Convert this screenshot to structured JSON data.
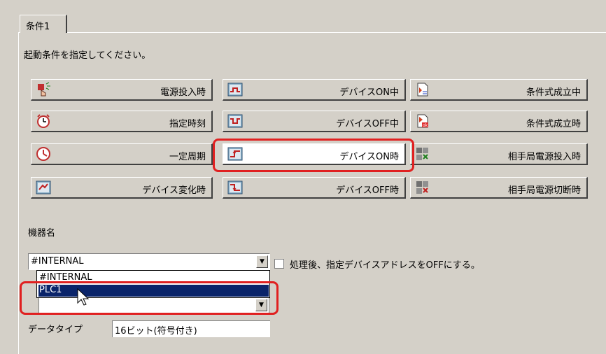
{
  "tab": {
    "label": "条件1"
  },
  "prompt": "起動条件を指定してください。",
  "buttons": [
    {
      "label": "電源投入時",
      "icon": "power-on-icon"
    },
    {
      "label": "デバイスON中",
      "icon": "device-on-icon"
    },
    {
      "label": "条件式成立中",
      "icon": "condition-icon"
    },
    {
      "label": "指定時刻",
      "icon": "alarm-clock-icon"
    },
    {
      "label": "デバイスOFF中",
      "icon": "device-off-icon"
    },
    {
      "label": "条件式成立時",
      "icon": "condition-ok-icon"
    },
    {
      "label": "一定周期",
      "icon": "clock-icon"
    },
    {
      "label": "デバイスON時",
      "icon": "device-on-rise-icon"
    },
    {
      "label": "相手局電源投入時",
      "icon": "remote-power-on-icon"
    },
    {
      "label": "デバイス変化時",
      "icon": "device-change-icon"
    },
    {
      "label": "デバイスOFF時",
      "icon": "device-off-fall-icon"
    },
    {
      "label": "相手局電源切断時",
      "icon": "remote-power-off-icon"
    }
  ],
  "device": {
    "section_label": "機器名",
    "selected": "#INTERNAL",
    "options": [
      "#INTERNAL",
      "PLC1"
    ],
    "checkbox_label": "処理後、指定デバイスアドレスをOFFにする。"
  },
  "data_type": {
    "label": "データタイプ",
    "value": "16ビット(符号付き)"
  },
  "colors": {
    "highlight": "#e02020",
    "selection": "#0a246a"
  }
}
